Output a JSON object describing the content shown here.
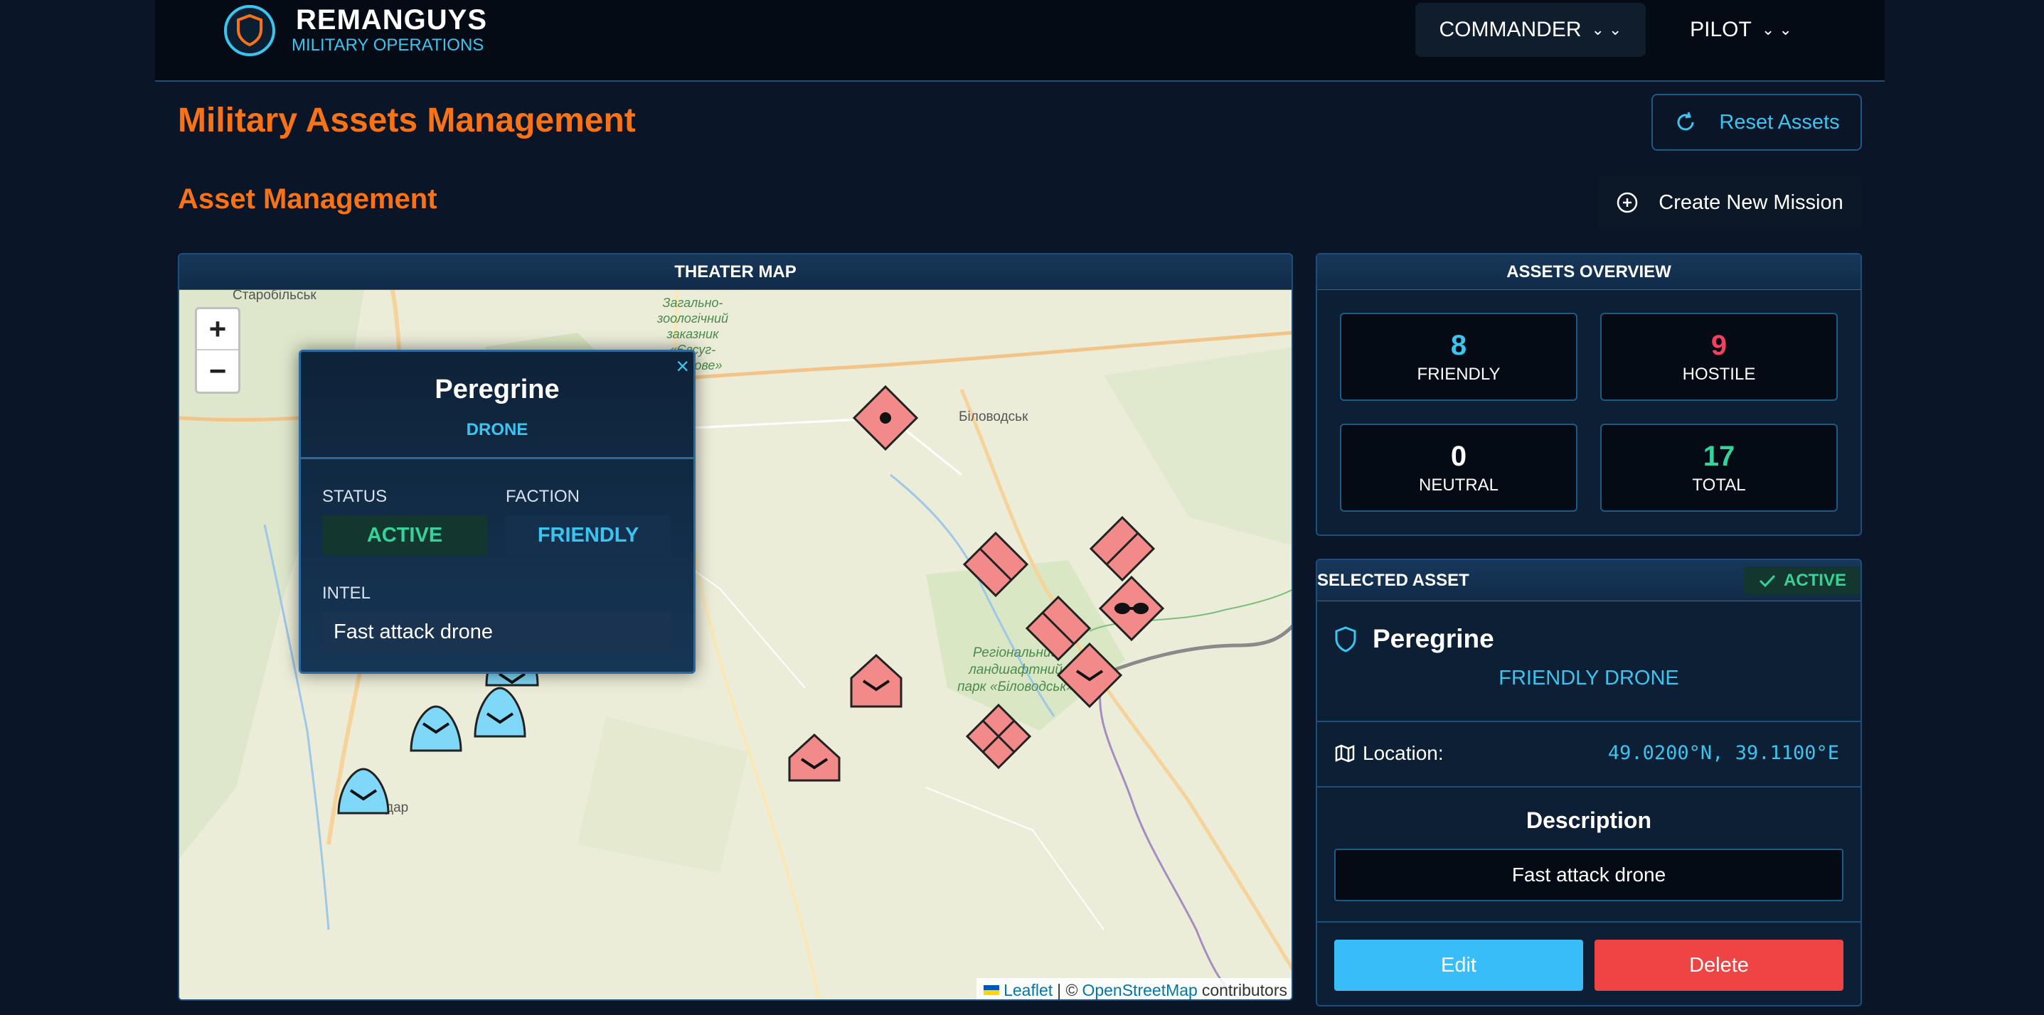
{
  "header": {
    "brand_title": "REMANGUYS",
    "brand_subtitle": "MILITARY OPERATIONS",
    "role_commander": "COMMANDER",
    "role_pilot": "PILOT"
  },
  "page": {
    "title": "Military Assets Management",
    "reset_label": "Reset Assets",
    "section_title": "Asset Management",
    "create_mission_label": "Create New Mission"
  },
  "map": {
    "panel_title": "THEATER MAP",
    "place_labels": {
      "starobilsk": "Старобільськ",
      "zakaznik_1": "Загально-",
      "zakaznik_2": "зоологічний",
      "zakaznik_3": "заказник",
      "zakaznik_4": "«Євсуг-",
      "zakaznik_5": "степове»",
      "bilovodsk": "Біловодськ",
      "park_1": "Регіональний",
      "park_2": "ландшафтний",
      "park_3": "парк «Біловодськ»",
      "town_dar": "дар"
    },
    "zoom_in": "+",
    "zoom_out": "−",
    "attribution_leaflet": "Leaflet",
    "attribution_sep": "| ©",
    "attribution_osm": "OpenStreetMap",
    "attribution_tail": "contributors",
    "colors": {
      "friendly": "#7fd8f7",
      "hostile": "#f28a8a"
    }
  },
  "popup": {
    "name": "Peregrine",
    "type": "DRONE",
    "status_label": "STATUS",
    "status_value": "ACTIVE",
    "faction_label": "FACTION",
    "faction_value": "FRIENDLY",
    "intel_label": "INTEL",
    "intel_value": "Fast attack drone",
    "close": "×"
  },
  "overview": {
    "title": "ASSETS OVERVIEW",
    "friendly_count": "8",
    "friendly_label": "FRIENDLY",
    "hostile_count": "9",
    "hostile_label": "HOSTILE",
    "neutral_count": "0",
    "neutral_label": "NEUTRAL",
    "total_count": "17",
    "total_label": "TOTAL"
  },
  "selected": {
    "title": "SELECTED ASSET",
    "badge": "ACTIVE",
    "name": "Peregrine",
    "type_line": "FRIENDLY DRONE",
    "location_label": "Location:",
    "location_value": "49.0200°N, 39.1100°E",
    "description_title": "Description",
    "description_value": "Fast attack drone",
    "edit_label": "Edit",
    "delete_label": "Delete"
  }
}
